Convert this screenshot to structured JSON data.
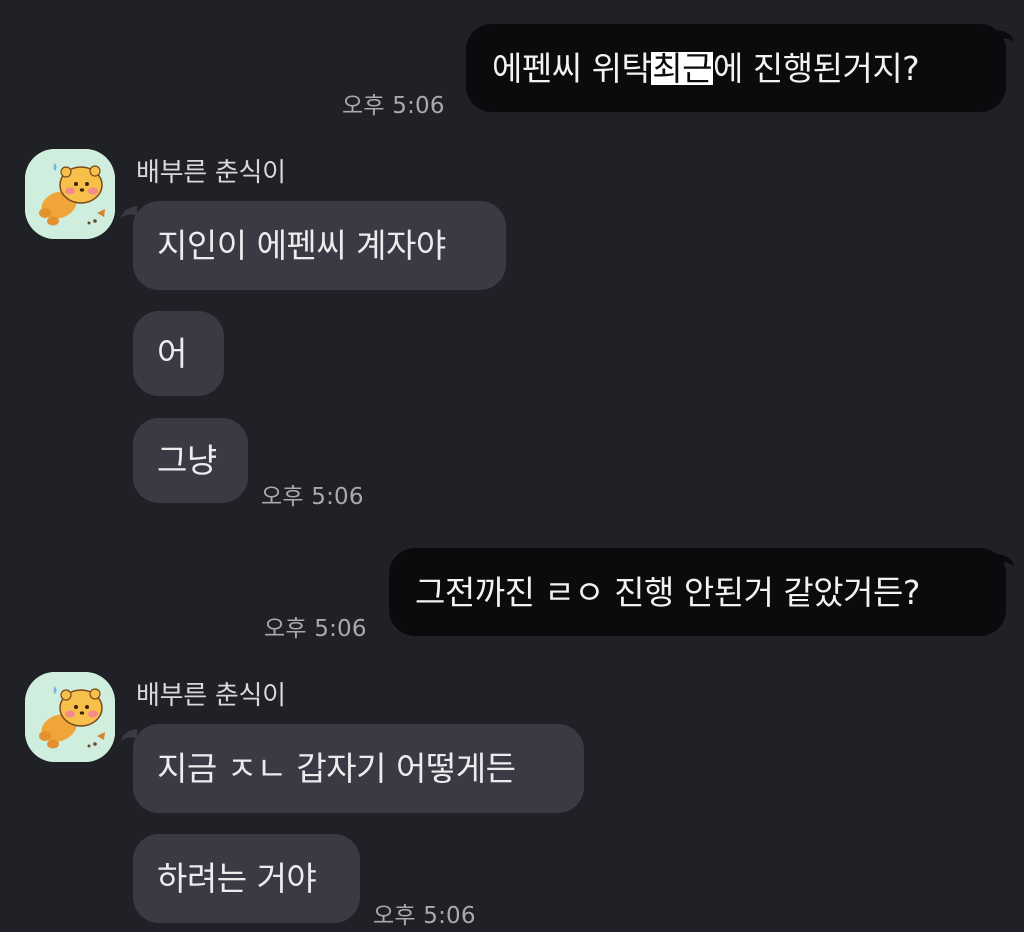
{
  "messages": [
    {
      "side": "me",
      "text_parts": [
        "에펜씨 위탁 ",
        "최근",
        "에 진행된거지?"
      ],
      "time": "오후 5:06"
    },
    {
      "side": "them",
      "sender": "배부른 춘식이",
      "avatar": "chunsik-avatar",
      "text": "지인이 에펜씨 계자야"
    },
    {
      "side": "them",
      "text": "어"
    },
    {
      "side": "them",
      "text": "그냥",
      "time": "오후 5:06"
    },
    {
      "side": "me",
      "text": "그전까진 ㄹㅇ 진행 안된거 같았거든?",
      "time": "오후 5:06"
    },
    {
      "side": "them",
      "sender": "배부른 춘식이",
      "avatar": "chunsik-avatar",
      "text": "지금 ㅈㄴ 갑자기 어떻게든"
    },
    {
      "side": "them",
      "text": "하려는 거야",
      "time": "오후 5:06"
    }
  ],
  "colors": {
    "background": "#202127",
    "my_bubble": "#0b0b0d",
    "their_bubble": "#393a43",
    "highlight": "#ffffff",
    "avatar_bg": "#cfeedd",
    "time_text": "#a9a9b0"
  }
}
